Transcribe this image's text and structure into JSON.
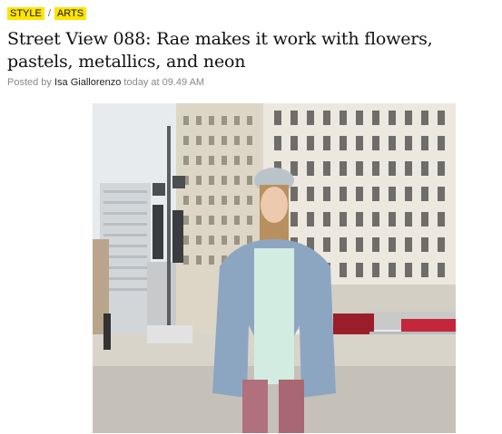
{
  "tags": [
    "STYLE",
    "ARTS"
  ],
  "tag_separator": "/",
  "headline": "Street View 088: Rae makes it work with flowers, pastels, metallics, and neon",
  "byline": {
    "prefix": "Posted by",
    "author": "Isa Giallorenzo",
    "time": "today at 09.49 AM"
  },
  "colors": {
    "tag_bg": "#ffe400",
    "sky": "#e9ecef",
    "building": "#c9bfa9",
    "jacket": "#8fa7bf",
    "shirt": "#cfe8dd"
  }
}
